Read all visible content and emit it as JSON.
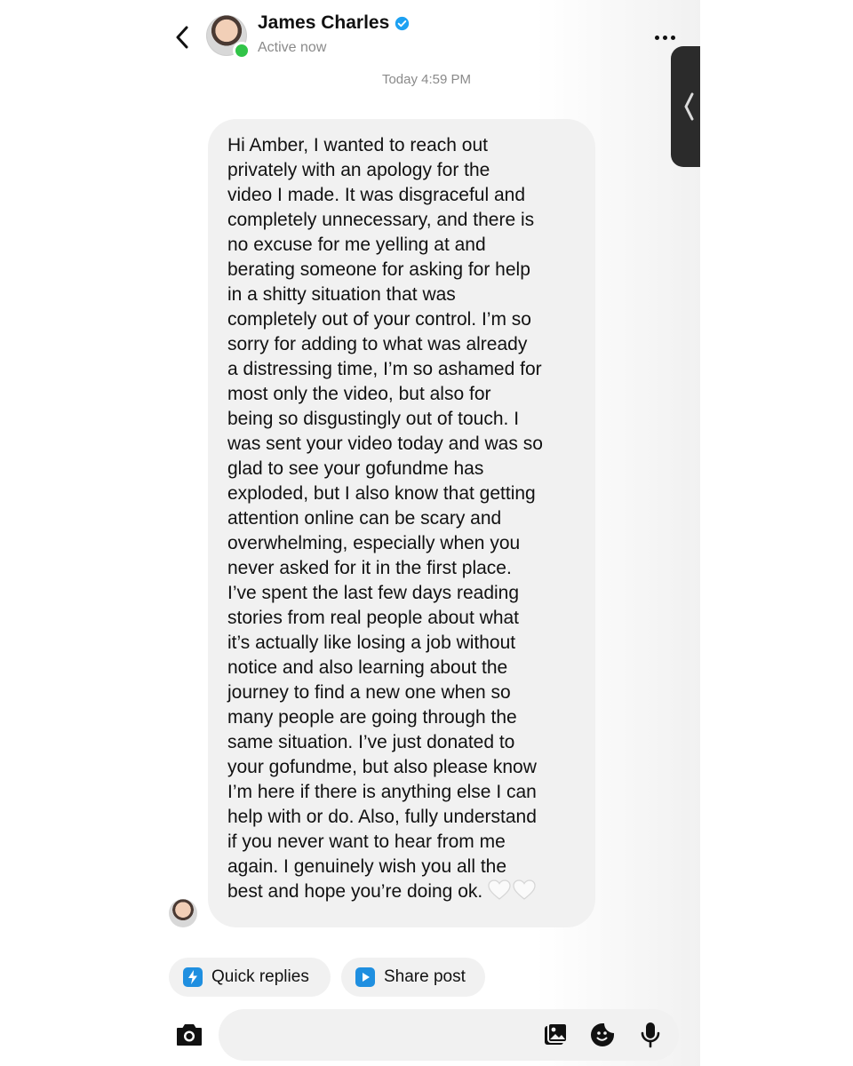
{
  "header": {
    "contact_name": "James Charles",
    "status": "Active now",
    "verified_color": "#1da1f2",
    "online_color": "#31c448"
  },
  "conversation": {
    "timestamp": "Today 4:59 PM",
    "message": "Hi Amber, I wanted to reach out\nprivately with an apology for the\nvideo I made. It was disgraceful and\ncompletely unnecessary, and there is\nno excuse for me yelling at and\nberating someone for asking for help\nin a shitty situation that was\ncompletely out of your control. I’m so\nsorry for adding to what was already\na distressing time, I’m so ashamed for\nmost only the video, but also for\nbeing so disgustingly out of touch. I\nwas sent your video today and was so\nglad to see your gofundme has\nexploded, but I also know that getting\nattention online can be scary and\noverwhelming, especially when you\nnever asked for it in the first place.\nI’ve spent the last few days reading\nstories from real people about what\nit’s actually like losing a job without\nnotice and also learning about the\njourney to find a new one when so\nmany people are going through the\nsame situation. I’ve just donated to\nyour gofundme, but also please know\nI’m here if there is anything else I can\nhelp with or do. Also, fully understand\nif you never want to hear from me\nagain. I genuinely wish you all the\nbest and hope you’re doing ok.",
    "emoji": [
      "white-heart-icon",
      "white-heart-icon"
    ]
  },
  "quick_actions": {
    "quick_replies_label": "Quick replies",
    "share_post_label": "Share post",
    "accent_color": "#1f8fe0"
  },
  "composer": {
    "value": "",
    "icons": [
      "camera-icon",
      "gallery-icon",
      "sticker-icon",
      "microphone-icon"
    ]
  }
}
